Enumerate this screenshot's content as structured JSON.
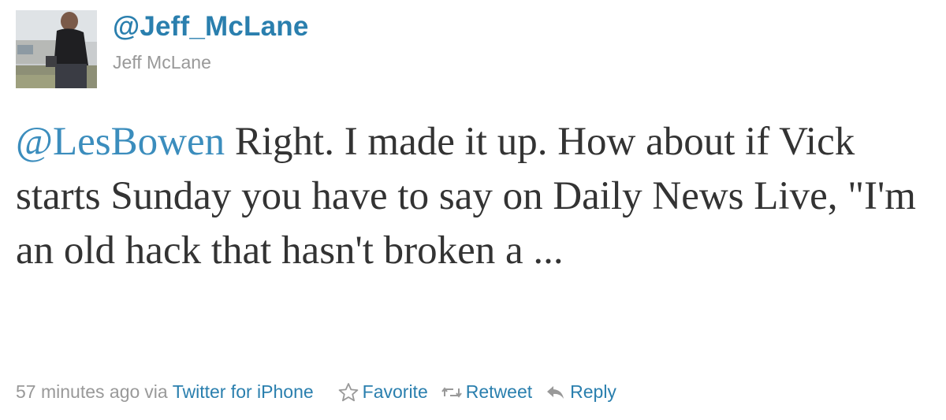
{
  "user": {
    "screen_name": "@Jeff_McLane",
    "full_name": "Jeff McLane"
  },
  "tweet": {
    "mention": "@LesBowen",
    "text_rest": " Right. I made it up. How about if Vick starts Sunday you have to say on Daily News Live, \"I'm an old hack that hasn't broken a ...",
    "timestamp": "57 minutes ago",
    "via_label": "via",
    "source": "Twitter for iPhone"
  },
  "actions": {
    "favorite": "Favorite",
    "retweet": "Retweet",
    "reply": "Reply"
  },
  "icons": {
    "favorite": "star-outline-icon",
    "retweet": "retweet-arrows-icon",
    "reply": "reply-arrow-icon"
  },
  "colors": {
    "link": "#2a7fae",
    "mention": "#3b8dbd",
    "text": "#333333",
    "muted": "#999999"
  }
}
